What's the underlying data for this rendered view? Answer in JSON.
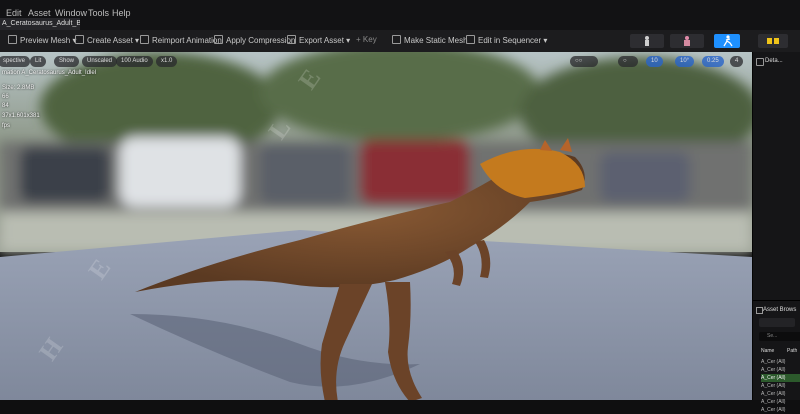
{
  "menu": [
    "Edit",
    "Asset",
    "Window",
    "Tools",
    "Help"
  ],
  "document_tab": "A_Ceratosaurus_Adult_B...",
  "toolbar": {
    "preview_mesh": "Preview Mesh",
    "create_asset": "Create Asset",
    "reimport_animation": "Reimport Animation",
    "apply_compression": "Apply Compression",
    "export_asset": "Export Asset",
    "key": "Key",
    "make_static_mesh": "Make Static Mesh",
    "edit_in_sequencer": "Edit in Sequencer"
  },
  "viewport": {
    "chips_left": [
      "spective",
      "Lit",
      "Show",
      "Unscaled",
      "100 Audio",
      "x1.0"
    ],
    "chips_right": [
      "10",
      "10°",
      "0.25",
      "4"
    ],
    "info_lines": [
      "mation A_Ceratosaurus_Adult_Idlel",
      "Size: 2.8MB",
      "66",
      "84",
      "37x1.601x381",
      "fps"
    ]
  },
  "details_panel": {
    "title": "Deta..."
  },
  "asset_browser": {
    "title": "Asset Brows",
    "search_placeholder": "Se...",
    "column_name": "Name",
    "column_path": "Path",
    "rows": [
      "A_Cer (All)",
      "A_Cer (All)",
      "A_Cer (All)",
      "A_Cer (All)",
      "A_Cer (All)",
      "A_Cer (All)",
      "A_Cer (All)"
    ]
  },
  "colors": {
    "accent": "#1e90ff",
    "toolbar_bg": "#1c1c1e",
    "panel_bg": "#151517",
    "floor": "#8d96a8"
  }
}
